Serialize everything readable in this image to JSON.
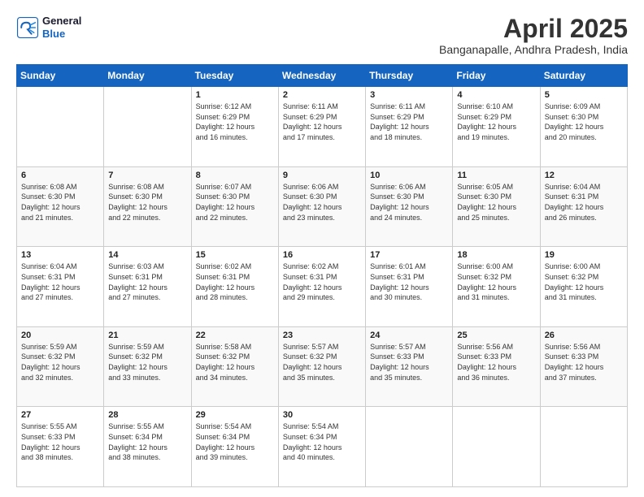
{
  "logo": {
    "line1": "General",
    "line2": "Blue"
  },
  "title": "April 2025",
  "subtitle": "Banganapalle, Andhra Pradesh, India",
  "days_header": [
    "Sunday",
    "Monday",
    "Tuesday",
    "Wednesday",
    "Thursday",
    "Friday",
    "Saturday"
  ],
  "weeks": [
    [
      {
        "day": "",
        "info": ""
      },
      {
        "day": "",
        "info": ""
      },
      {
        "day": "1",
        "info": "Sunrise: 6:12 AM\nSunset: 6:29 PM\nDaylight: 12 hours\nand 16 minutes."
      },
      {
        "day": "2",
        "info": "Sunrise: 6:11 AM\nSunset: 6:29 PM\nDaylight: 12 hours\nand 17 minutes."
      },
      {
        "day": "3",
        "info": "Sunrise: 6:11 AM\nSunset: 6:29 PM\nDaylight: 12 hours\nand 18 minutes."
      },
      {
        "day": "4",
        "info": "Sunrise: 6:10 AM\nSunset: 6:29 PM\nDaylight: 12 hours\nand 19 minutes."
      },
      {
        "day": "5",
        "info": "Sunrise: 6:09 AM\nSunset: 6:30 PM\nDaylight: 12 hours\nand 20 minutes."
      }
    ],
    [
      {
        "day": "6",
        "info": "Sunrise: 6:08 AM\nSunset: 6:30 PM\nDaylight: 12 hours\nand 21 minutes."
      },
      {
        "day": "7",
        "info": "Sunrise: 6:08 AM\nSunset: 6:30 PM\nDaylight: 12 hours\nand 22 minutes."
      },
      {
        "day": "8",
        "info": "Sunrise: 6:07 AM\nSunset: 6:30 PM\nDaylight: 12 hours\nand 22 minutes."
      },
      {
        "day": "9",
        "info": "Sunrise: 6:06 AM\nSunset: 6:30 PM\nDaylight: 12 hours\nand 23 minutes."
      },
      {
        "day": "10",
        "info": "Sunrise: 6:06 AM\nSunset: 6:30 PM\nDaylight: 12 hours\nand 24 minutes."
      },
      {
        "day": "11",
        "info": "Sunrise: 6:05 AM\nSunset: 6:30 PM\nDaylight: 12 hours\nand 25 minutes."
      },
      {
        "day": "12",
        "info": "Sunrise: 6:04 AM\nSunset: 6:31 PM\nDaylight: 12 hours\nand 26 minutes."
      }
    ],
    [
      {
        "day": "13",
        "info": "Sunrise: 6:04 AM\nSunset: 6:31 PM\nDaylight: 12 hours\nand 27 minutes."
      },
      {
        "day": "14",
        "info": "Sunrise: 6:03 AM\nSunset: 6:31 PM\nDaylight: 12 hours\nand 27 minutes."
      },
      {
        "day": "15",
        "info": "Sunrise: 6:02 AM\nSunset: 6:31 PM\nDaylight: 12 hours\nand 28 minutes."
      },
      {
        "day": "16",
        "info": "Sunrise: 6:02 AM\nSunset: 6:31 PM\nDaylight: 12 hours\nand 29 minutes."
      },
      {
        "day": "17",
        "info": "Sunrise: 6:01 AM\nSunset: 6:31 PM\nDaylight: 12 hours\nand 30 minutes."
      },
      {
        "day": "18",
        "info": "Sunrise: 6:00 AM\nSunset: 6:32 PM\nDaylight: 12 hours\nand 31 minutes."
      },
      {
        "day": "19",
        "info": "Sunrise: 6:00 AM\nSunset: 6:32 PM\nDaylight: 12 hours\nand 31 minutes."
      }
    ],
    [
      {
        "day": "20",
        "info": "Sunrise: 5:59 AM\nSunset: 6:32 PM\nDaylight: 12 hours\nand 32 minutes."
      },
      {
        "day": "21",
        "info": "Sunrise: 5:59 AM\nSunset: 6:32 PM\nDaylight: 12 hours\nand 33 minutes."
      },
      {
        "day": "22",
        "info": "Sunrise: 5:58 AM\nSunset: 6:32 PM\nDaylight: 12 hours\nand 34 minutes."
      },
      {
        "day": "23",
        "info": "Sunrise: 5:57 AM\nSunset: 6:32 PM\nDaylight: 12 hours\nand 35 minutes."
      },
      {
        "day": "24",
        "info": "Sunrise: 5:57 AM\nSunset: 6:33 PM\nDaylight: 12 hours\nand 35 minutes."
      },
      {
        "day": "25",
        "info": "Sunrise: 5:56 AM\nSunset: 6:33 PM\nDaylight: 12 hours\nand 36 minutes."
      },
      {
        "day": "26",
        "info": "Sunrise: 5:56 AM\nSunset: 6:33 PM\nDaylight: 12 hours\nand 37 minutes."
      }
    ],
    [
      {
        "day": "27",
        "info": "Sunrise: 5:55 AM\nSunset: 6:33 PM\nDaylight: 12 hours\nand 38 minutes."
      },
      {
        "day": "28",
        "info": "Sunrise: 5:55 AM\nSunset: 6:34 PM\nDaylight: 12 hours\nand 38 minutes."
      },
      {
        "day": "29",
        "info": "Sunrise: 5:54 AM\nSunset: 6:34 PM\nDaylight: 12 hours\nand 39 minutes."
      },
      {
        "day": "30",
        "info": "Sunrise: 5:54 AM\nSunset: 6:34 PM\nDaylight: 12 hours\nand 40 minutes."
      },
      {
        "day": "",
        "info": ""
      },
      {
        "day": "",
        "info": ""
      },
      {
        "day": "",
        "info": ""
      }
    ]
  ]
}
